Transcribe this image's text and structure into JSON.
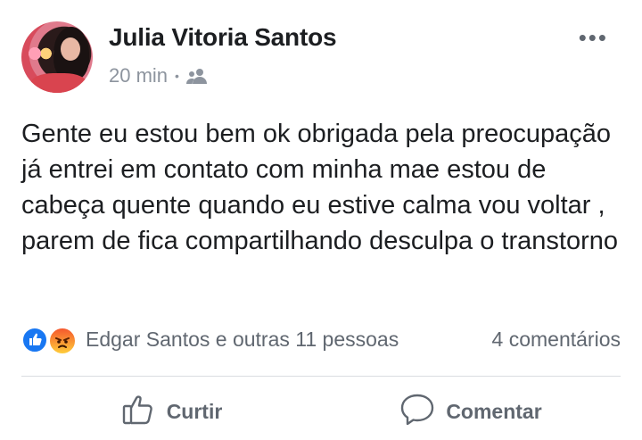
{
  "post": {
    "author_name": "Julia Vitoria Santos",
    "time": "20 min",
    "separator": "•",
    "audience_icon": "group-icon",
    "more_icon": "more-options-icon",
    "more_label": "•••",
    "text": "Gente eu estou bem ok obrigada pela preocupação já entrei em contato com minha mae estou de cabeça quente quando eu estive calma vou voltar , parem de fica compartilhando desculpa o transtorno"
  },
  "reactions": {
    "icons": [
      "like-icon",
      "angry-icon"
    ],
    "names": "Edgar Santos e outras 11 pessoas",
    "comments": "4 comentários"
  },
  "actions": {
    "like_label": "Curtir",
    "comment_label": "Comentar"
  },
  "colors": {
    "like_blue": "#1877f2",
    "meta_gray": "#8d949e",
    "action_gray": "#606770"
  }
}
